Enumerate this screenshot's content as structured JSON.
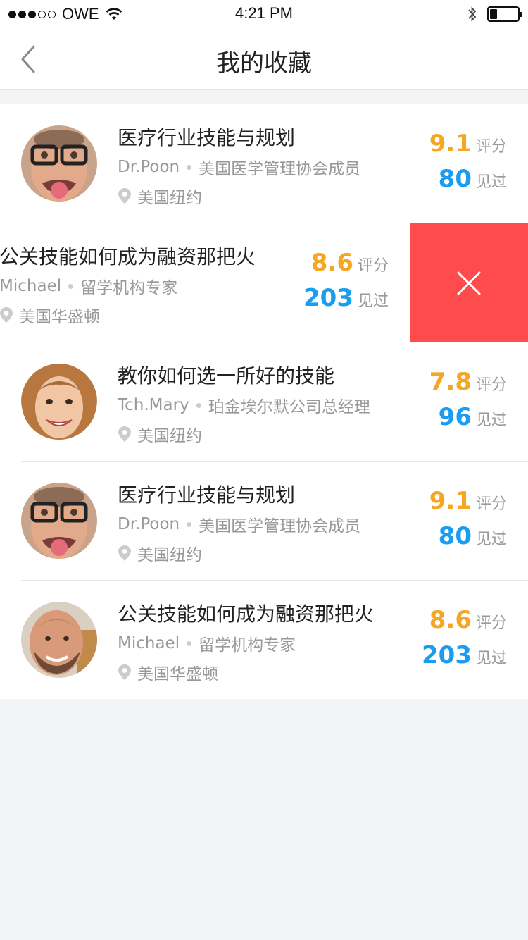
{
  "status_bar": {
    "carrier": "OWE",
    "time": "4:21 PM"
  },
  "nav": {
    "title": "我的收藏",
    "back_icon": "chevron-left-icon"
  },
  "colors": {
    "score": "#f5a623",
    "views": "#1a9cf0",
    "delete": "#ff4b4b"
  },
  "items": [
    {
      "title": "医疗行业技能与规划",
      "author": "Dr.Poon",
      "role": "美国医学管理协会成员",
      "location": "美国纽约",
      "score": "9.1",
      "score_unit": "评分",
      "views": "80",
      "views_unit": "见过"
    },
    {
      "title": "公关技能如何成为融资那把火",
      "author": "Michael",
      "role": "留学机构专家",
      "location": "美国华盛顿",
      "score": "8.6",
      "score_unit": "评分",
      "views": "203",
      "views_unit": "见过"
    },
    {
      "title": "教你如何选一所好的技能",
      "author": "Tch.Mary",
      "role": "珀金埃尔默公司总经理",
      "location": "美国纽约",
      "score": "7.8",
      "score_unit": "评分",
      "views": "96",
      "views_unit": "见过"
    },
    {
      "title": "医疗行业技能与规划",
      "author": "Dr.Poon",
      "role": "美国医学管理协会成员",
      "location": "美国纽约",
      "score": "9.1",
      "score_unit": "评分",
      "views": "80",
      "views_unit": "见过"
    },
    {
      "title": "公关技能如何成为融资那把火",
      "author": "Michael",
      "role": "留学机构专家",
      "location": "美国华盛顿",
      "score": "8.6",
      "score_unit": "评分",
      "views": "203",
      "views_unit": "见过"
    }
  ]
}
